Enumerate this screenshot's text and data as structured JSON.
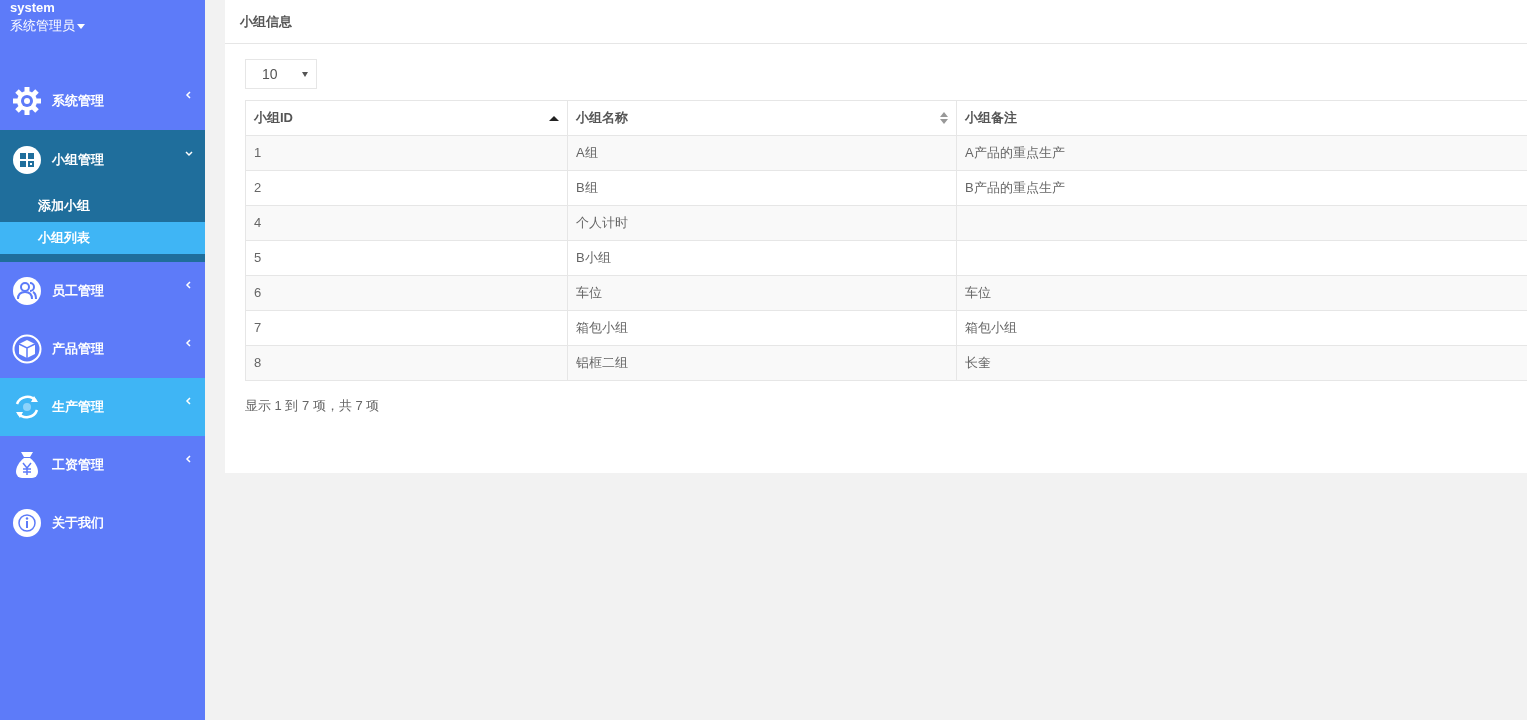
{
  "user": {
    "name": "system",
    "role": "系统管理员"
  },
  "sidebar": {
    "items": [
      {
        "label": "系统管理",
        "kind": "menu",
        "expanded": false,
        "highlighted": false
      },
      {
        "label": "小组管理",
        "kind": "menu",
        "expanded": true,
        "highlighted": false,
        "children": [
          {
            "label": "添加小组",
            "selected": false
          },
          {
            "label": "小组列表",
            "selected": true
          }
        ]
      },
      {
        "label": "员工管理",
        "kind": "menu",
        "expanded": false,
        "highlighted": false
      },
      {
        "label": "产品管理",
        "kind": "menu",
        "expanded": false,
        "highlighted": false
      },
      {
        "label": "生产管理",
        "kind": "menu",
        "expanded": false,
        "highlighted": true
      },
      {
        "label": "工资管理",
        "kind": "menu",
        "expanded": false,
        "highlighted": false
      },
      {
        "label": "关于我们",
        "kind": "link",
        "highlighted": false
      }
    ]
  },
  "panel": {
    "title": "小组信息",
    "page_size": "10",
    "table": {
      "columns": [
        {
          "label": "小组ID",
          "sortable": true,
          "sorted": true
        },
        {
          "label": "小组名称",
          "sortable": true,
          "sorted": false
        },
        {
          "label": "小组备注",
          "sortable": false
        }
      ],
      "rows": [
        [
          "1",
          "A组",
          "A产品的重点生产"
        ],
        [
          "2",
          "B组",
          "B产品的重点生产"
        ],
        [
          "4",
          "个人计时",
          ""
        ],
        [
          "5",
          "B小组",
          ""
        ],
        [
          "6",
          "车位",
          "车位"
        ],
        [
          "7",
          "箱包小组",
          "箱包小组"
        ],
        [
          "8",
          "铝框二组",
          "长奎"
        ]
      ]
    },
    "summary": "显示 1 到 7 项，共 7 项"
  }
}
